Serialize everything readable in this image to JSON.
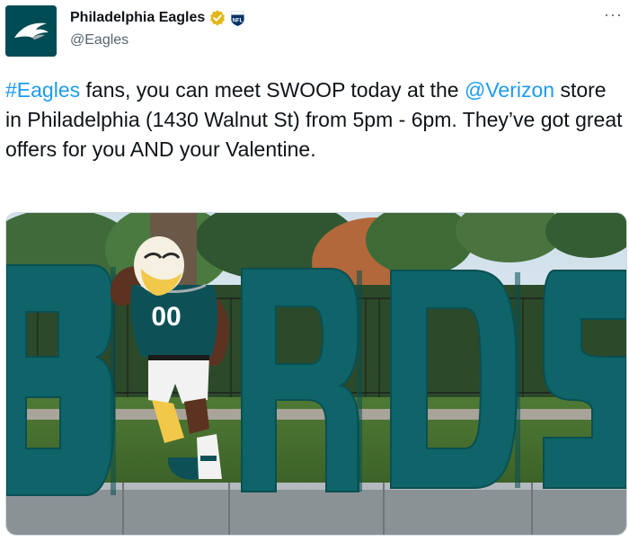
{
  "author": {
    "display_name": "Philadelphia Eagles",
    "handle": "@Eagles",
    "verified_icon": "gold-verified-badge-icon",
    "affiliate_icon": "nfl-shield-icon",
    "more_label": "···"
  },
  "tweet": {
    "hashtag": "#Eagles",
    "text_1": " fans, you can meet SWOOP today at the ",
    "mention": "@Verizon",
    "text_2": " store in Philadelphia (1430 Walnut St) from 5pm - 6pm. They’ve got great offers for you AND your Valentine."
  },
  "media": {
    "sign_letters": [
      "B",
      "I",
      "R",
      "D",
      "S"
    ],
    "jersey_number": "00"
  },
  "colors": {
    "accent_link": "#1d9bf0",
    "eagles_teal": "#0e6468",
    "eagles_green": "#004c54",
    "verified_gold": "#e2b719"
  }
}
